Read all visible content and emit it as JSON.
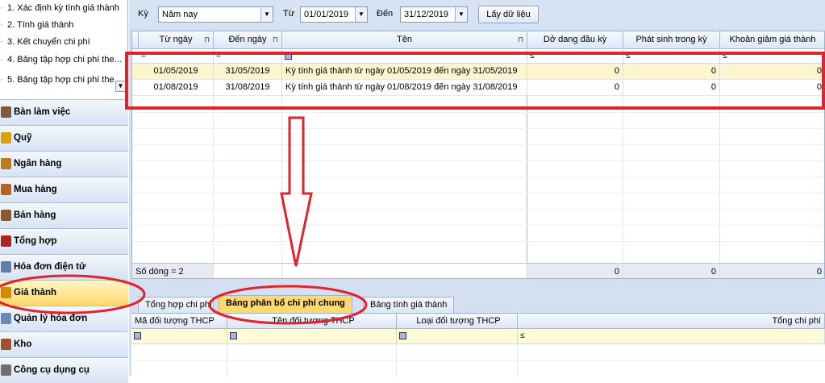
{
  "sidebar": {
    "task_list": [
      {
        "num": "1",
        "label": "1. Xác định kỳ tính giá thành"
      },
      {
        "num": "2",
        "label": "2. Tính giá thành"
      },
      {
        "num": "3",
        "label": "3. Kết chuyển chi phí"
      },
      {
        "num": "4",
        "label": "4. Bảng tập hợp chi phí the..."
      },
      {
        "num": "5",
        "label": "5. Bảng tập hợp chi phí the..."
      }
    ],
    "modules": [
      {
        "label": "Bàn làm việc",
        "icon": "desk-icon",
        "color": "#7b5b3a"
      },
      {
        "label": "Quỹ",
        "icon": "cash-icon",
        "color": "#d9a400"
      },
      {
        "label": "Ngân hàng",
        "icon": "bank-icon",
        "color": "#c07a1a"
      },
      {
        "label": "Mua hàng",
        "icon": "purchase-icon",
        "color": "#b8641e"
      },
      {
        "label": "Bán hàng",
        "icon": "sales-icon",
        "color": "#8a5a2b"
      },
      {
        "label": "Tổng hợp",
        "icon": "summary-icon",
        "color": "#b22222"
      },
      {
        "label": "Hóa đơn điện tử",
        "icon": "einvoice-icon",
        "color": "#5f7fa8"
      },
      {
        "label": "Giá thành",
        "icon": "cost-icon",
        "color": "#d48a00"
      },
      {
        "label": "Quản lý hóa đơn",
        "icon": "invoice-icon",
        "color": "#6a8ab8"
      },
      {
        "label": "Kho",
        "icon": "warehouse-icon",
        "color": "#a0522d"
      },
      {
        "label": "Công cụ dụng cụ",
        "icon": "tools-icon",
        "color": "#707070"
      }
    ],
    "active_module_index": 7
  },
  "toolbar": {
    "period_label": "Kỳ",
    "period_value": "Năm nay",
    "from_label": "Từ",
    "from_value": "01/01/2019",
    "to_label": "Đến",
    "to_value": "31/12/2019",
    "load_button": "Lấy dữ liệu"
  },
  "grid": {
    "columns": [
      "Từ ngày",
      "Đến ngày",
      "Tên",
      "Dở dang đầu kỳ",
      "Phát sinh trong kỳ",
      "Khoản giảm giá thành"
    ],
    "filter_ops": [
      "=",
      "=",
      "",
      "≤",
      "≤",
      "≤"
    ],
    "rows": [
      {
        "from": "01/05/2019",
        "to": "31/05/2019",
        "name": "Kỳ tính giá thành từ ngày 01/05/2019 đến ngày 31/05/2019",
        "wip": "0",
        "incurred": "0",
        "reduction": "0"
      },
      {
        "from": "01/08/2019",
        "to": "31/08/2019",
        "name": "Kỳ tính giá thành từ ngày 01/08/2019 đến ngày 31/08/2019",
        "wip": "0",
        "incurred": "0",
        "reduction": "0"
      }
    ],
    "footer": {
      "row_count": "Số dòng = 2",
      "wip": "0",
      "incurred": "0",
      "reduction": "0"
    }
  },
  "tabs": [
    {
      "label": "Tổng hợp chi phí"
    },
    {
      "label": "Bảng phân bổ chi phí chung"
    },
    {
      "label": "Bảng tính giá thành"
    }
  ],
  "bottom_grid": {
    "columns": [
      "Mã đối tượng THCP",
      "Tên đối tượng THCP",
      "Loại đối tượng THCP",
      "Tổng chi phí"
    ],
    "filter_ops": [
      "",
      "",
      "",
      "≤"
    ]
  },
  "annotation_color": "#e0242b"
}
